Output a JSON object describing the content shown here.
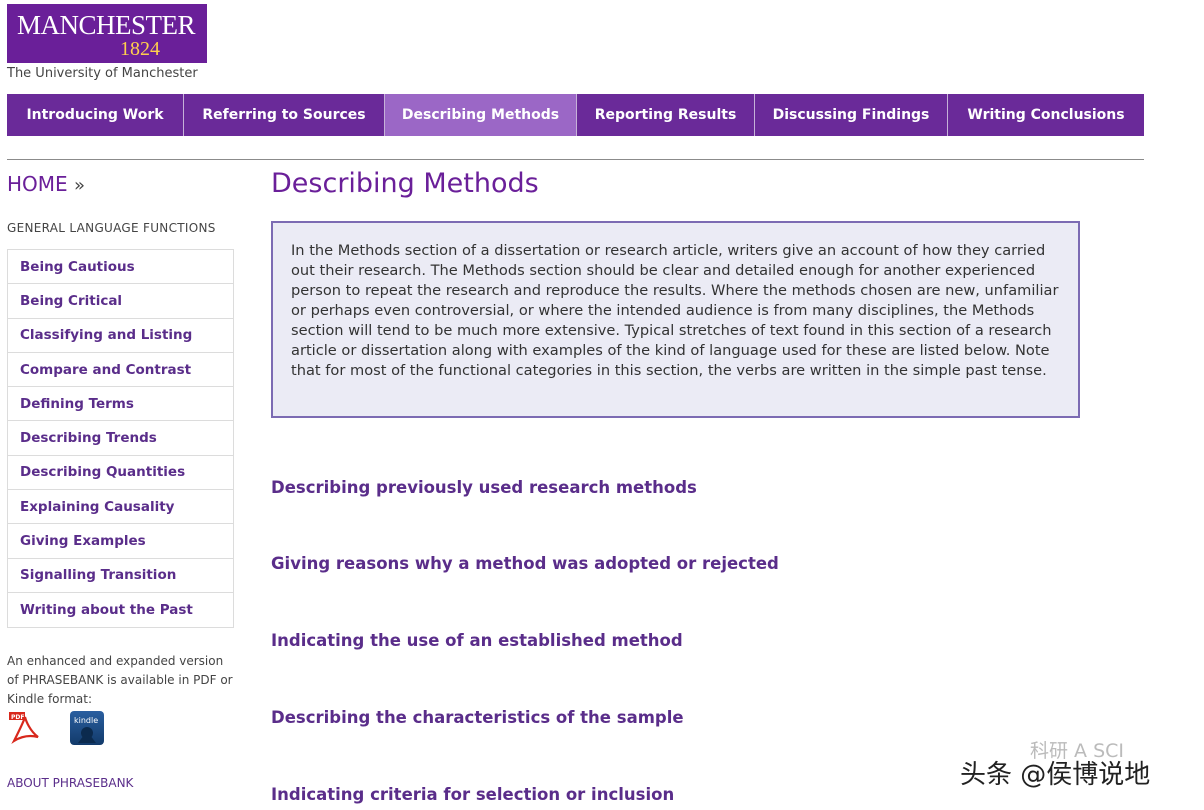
{
  "brand": {
    "word": "MANCHESTER",
    "year": "1824",
    "subtitle": "The University of Manchester"
  },
  "nav": {
    "items": [
      {
        "label": "Introducing Work",
        "active": false
      },
      {
        "label": "Referring to Sources",
        "active": false
      },
      {
        "label": "Describing Methods",
        "active": true
      },
      {
        "label": "Reporting Results",
        "active": false
      },
      {
        "label": "Discussing Findings",
        "active": false
      },
      {
        "label": "Writing Conclusions",
        "active": false
      }
    ]
  },
  "sidebar": {
    "home": "HOME",
    "home_arrow": "»",
    "heading": "GENERAL LANGUAGE FUNCTIONS",
    "items": [
      "Being Cautious",
      "Being Critical",
      "Classifying and Listing",
      "Compare and Contrast",
      "Defining Terms",
      "Describing Trends",
      "Describing Quantities",
      "Explaining Causality",
      "Giving Examples",
      "Signalling Transition",
      "Writing about the Past"
    ],
    "enhanced_text": "An enhanced and expanded version of PHRASEBANK is available in PDF or Kindle format:",
    "pdf_label": "PDF",
    "kindle_label": "kindle",
    "about": "ABOUT PHRASEBANK"
  },
  "main": {
    "title": "Describing Methods",
    "intro": "In the Methods section of a dissertation or research article, writers give an account of how they carried out their research. The Methods section should be clear and detailed enough for another experienced person to repeat the research and reproduce the results. Where the methods chosen are new, unfamiliar or perhaps even controversial, or where the intended audience is from many disciplines, the Methods section will tend to be much more extensive. Typical stretches of text found in this section of a research article or dissertation along with examples of the kind of language used for these are listed below. Note that for most of the functional categories in this section, the verbs are written in the simple past tense.",
    "sections": [
      "Describing previously used research methods",
      "Giving reasons why a method was adopted or rejected",
      "Indicating the use of an established method",
      "Describing the characteristics of the sample",
      "Indicating criteria for selection or inclusion"
    ]
  },
  "watermark": {
    "text": "头条 @侯博说地",
    "faint": "科研 A SCI"
  },
  "colors": {
    "brand_purple": "#6a1f99",
    "nav_active": "#9b67c6",
    "link_purple": "#5a2d8a",
    "box_bg": "#ebebf5",
    "box_border": "#7c6bb3",
    "logo_year": "#ffd04d"
  }
}
